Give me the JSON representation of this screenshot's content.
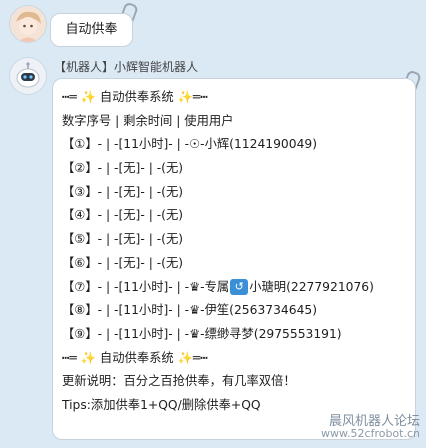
{
  "user_message": "自动供奉",
  "bot": {
    "sender_name": "【机器人】小辉智能机器人",
    "lines": [
      "┅═ ✨ 自动供奉系统 ✨═┅",
      "数字序号 | 剩余时间 | 使用用户",
      "【①】- | -[11小时]- | -☉-小辉(1124190049)",
      "【②】- | -[无]- | -(无)",
      "【③】- | -[无]- | -(无)",
      "【④】- | -[无]- | -(无)",
      "【⑤】- | -[无]- | -(无)",
      "【⑥】- | -[无]- | -(无)",
      "【⑦】- | -[11小时]- | -♛-专属",
      "【⑧】- | -[11小时]- | -♛-伊笙(2563734645)",
      "【⑨】- | -[11小时]- | -♛-缥缈寻梦(2975553191)",
      "┅═ ✨ 自动供奉系统 ✨═┅",
      "更新说明：百分之百抢供奉，有几率双倍！",
      "Tips:添加供奉1+QQ/删除供奉+QQ"
    ],
    "line7_suffix": "小瑭明(2277921076)"
  },
  "watermark": {
    "line1": "晨风机器人论坛",
    "line2": "www.52cfrobot.cn"
  },
  "icons": {
    "user_avatar": "user-avatar",
    "bot_avatar": "robot-avatar",
    "return_icon": "return-arrow-icon"
  }
}
